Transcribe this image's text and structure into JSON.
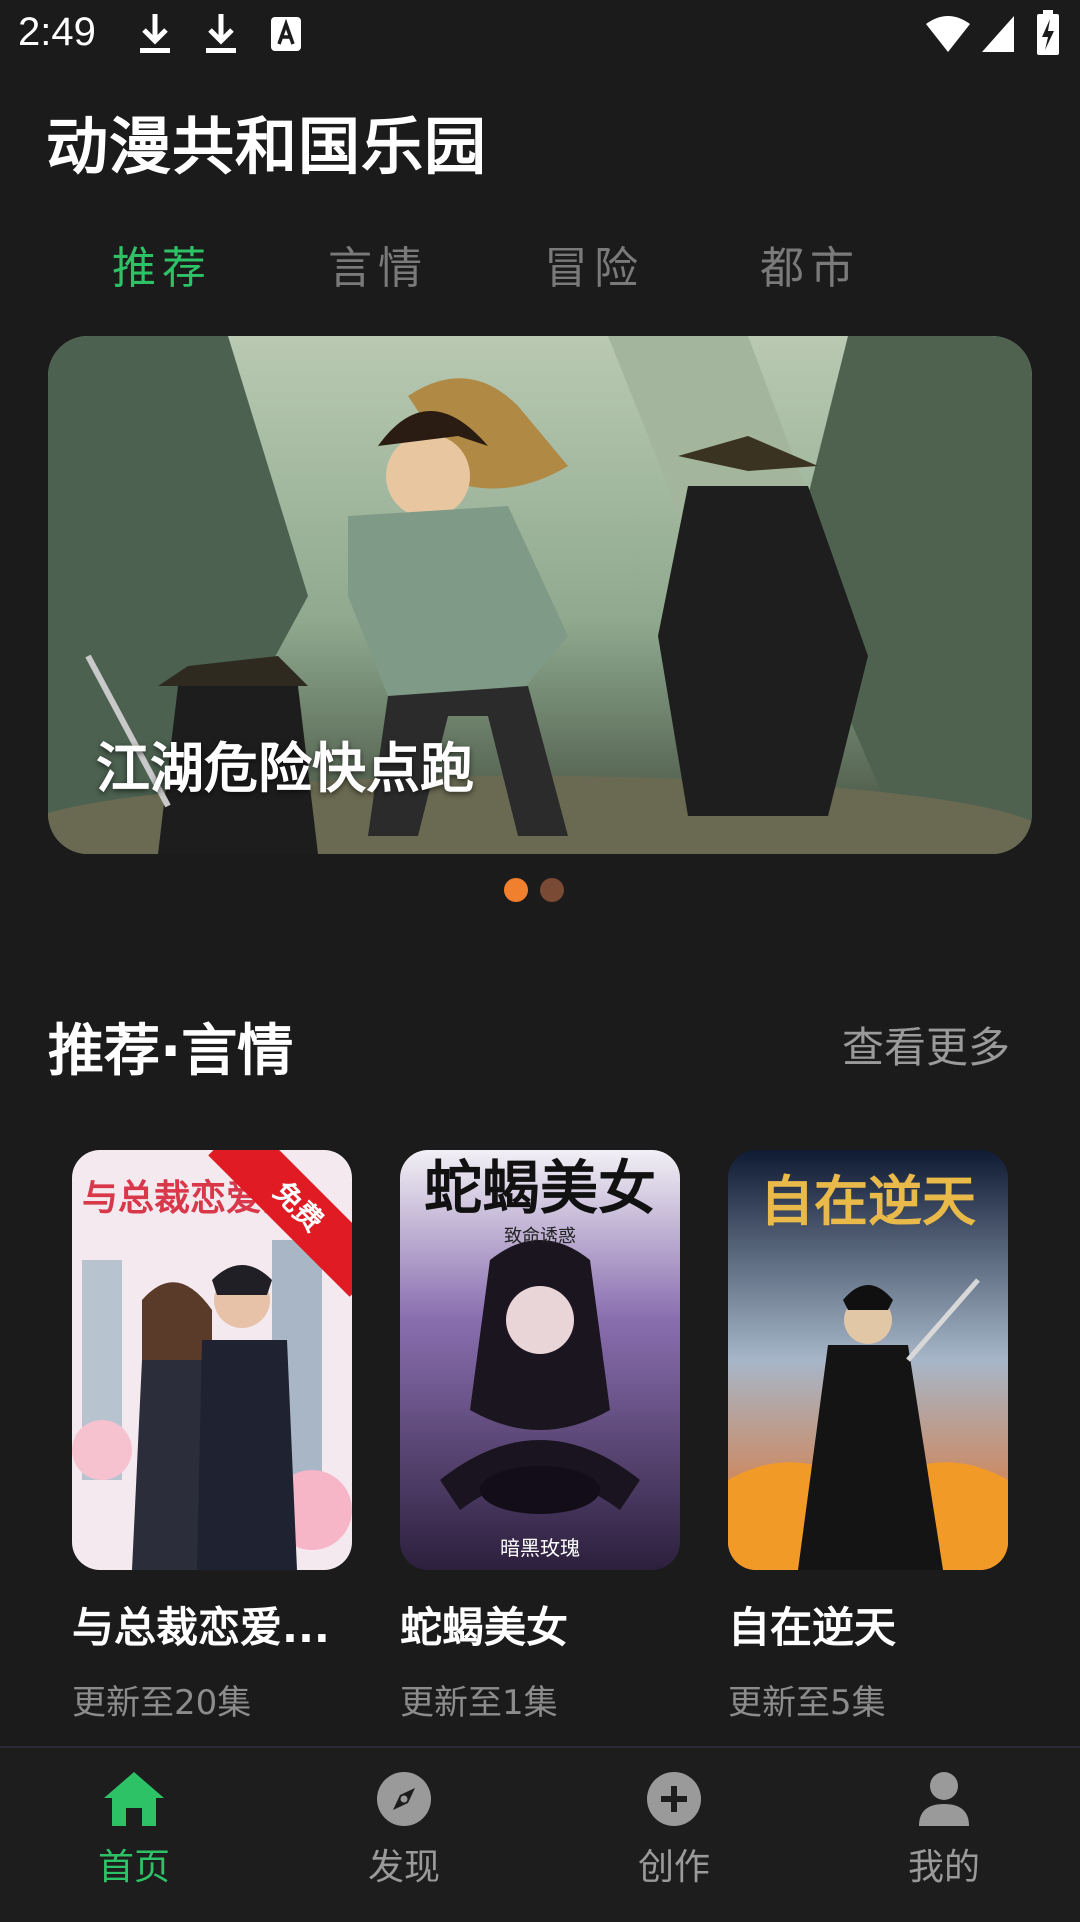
{
  "status_bar": {
    "time": "2:49"
  },
  "app": {
    "title": "动漫共和国乐园"
  },
  "tabs": [
    {
      "label": "推荐",
      "active": true
    },
    {
      "label": "言情",
      "active": false
    },
    {
      "label": "冒险",
      "active": false
    },
    {
      "label": "都市",
      "active": false
    }
  ],
  "banner": {
    "caption": "江湖危险快点跑",
    "pager": {
      "current": 1,
      "total": 2
    }
  },
  "section": {
    "title": "推荐·言情",
    "more_label": "查看更多"
  },
  "cards": [
    {
      "cover_text": "与总裁恋爱的",
      "title": "与总裁恋爱...",
      "subtitle": "更新至20集",
      "badge": "免费"
    },
    {
      "cover_text": "蛇蝎美女",
      "cover_sub": "致命诱惑",
      "cover_bottom": "暗黑玫瑰",
      "title": "蛇蝎美女",
      "subtitle": "更新至1集"
    },
    {
      "cover_text": "自在逆天",
      "title": "自在逆天",
      "subtitle": "更新至5集"
    }
  ],
  "bottom_nav": [
    {
      "label": "首页",
      "icon": "home-icon",
      "active": true
    },
    {
      "label": "发现",
      "icon": "compass-icon",
      "active": false
    },
    {
      "label": "创作",
      "icon": "plus-circle-icon",
      "active": false
    },
    {
      "label": "我的",
      "icon": "person-icon",
      "active": false
    }
  ],
  "colors": {
    "accent": "#2ec266",
    "badge": "#e01b24",
    "dot_active": "#f07f2e",
    "dot_inactive": "#7a4a35"
  }
}
